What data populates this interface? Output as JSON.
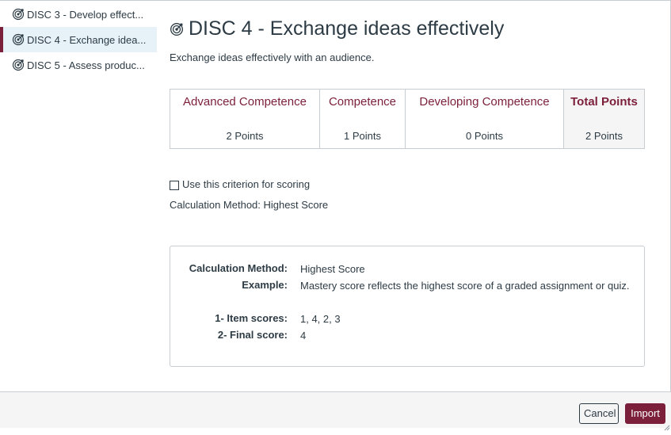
{
  "sidebar": {
    "items": [
      {
        "label": "DISC 3 - Develop effect...",
        "icon": "outcome-target-icon",
        "active": false
      },
      {
        "label": "DISC 4 - Exchange idea...",
        "icon": "outcome-target-icon",
        "active": true
      },
      {
        "label": "DISC 5 - Assess produc...",
        "icon": "outcome-target-icon",
        "active": false
      }
    ]
  },
  "main": {
    "title": "DISC 4 - Exchange ideas effectively",
    "title_icon": "outcome-target-icon",
    "description": "Exchange ideas effectively with an audience."
  },
  "rubric": {
    "columns": [
      {
        "header": "Advanced Competence",
        "points": "2 Points"
      },
      {
        "header": "Competence",
        "points": "1 Points"
      },
      {
        "header": "Developing Competence",
        "points": "0 Points"
      },
      {
        "header": "Total Points",
        "points": "2 Points"
      }
    ]
  },
  "criterion": {
    "checkbox_label": "Use this criterion for scoring",
    "checked": false,
    "calculation_line": "Calculation Method: Highest Score"
  },
  "info": {
    "rows": [
      {
        "key": "Calculation Method:",
        "value": "Highest Score"
      },
      {
        "key": "Example:",
        "value": "Mastery score reflects the highest score of a graded assignment or quiz."
      },
      {
        "key": "1- Item scores:",
        "value": "1, 4, 2, 3"
      },
      {
        "key": "2- Final score:",
        "value": "4"
      }
    ]
  },
  "footer": {
    "cancel_label": "Cancel",
    "import_label": "Import"
  },
  "colors": {
    "accent": "#7b1f3a",
    "text": "#2d3b45",
    "border": "#c7cdd1",
    "active_bg": "#e7f2f8"
  }
}
